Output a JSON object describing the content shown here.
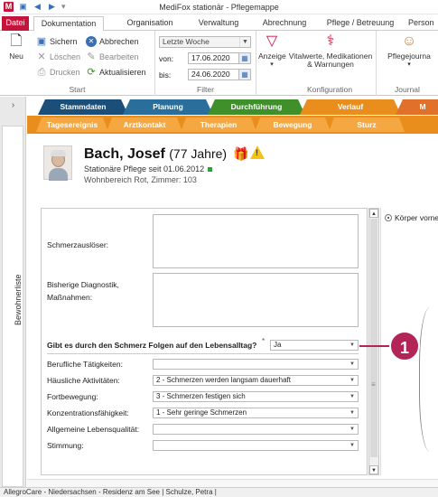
{
  "window": {
    "title": "MediFox stationär - Pflegemappe"
  },
  "quick_access": [
    "app-icon",
    "save-icon",
    "back-arrow-icon",
    "forward-arrow-icon",
    "customize-icon"
  ],
  "ribbon_tabs": [
    {
      "label": "Datei"
    },
    {
      "label": "Dokumentation"
    },
    {
      "label": "Organisation"
    },
    {
      "label": "Verwaltung"
    },
    {
      "label": "Abrechnung"
    },
    {
      "label": "Pflege / Betreuung"
    },
    {
      "label": "Person"
    }
  ],
  "ribbon": {
    "start": {
      "label": "Start",
      "neu": "Neu",
      "sichern": "Sichern",
      "abbrechen": "Abbrechen",
      "loeschen": "Löschen",
      "bearbeiten": "Bearbeiten",
      "drucken": "Drucken",
      "aktualisieren": "Aktualisieren"
    },
    "filter": {
      "label": "Filter",
      "period": "Letzte Woche",
      "von_label": "von:",
      "von": "17.06.2020",
      "bis_label": "bis:",
      "bis": "24.06.2020",
      "anzeige": "Anzeige"
    },
    "konfiguration": {
      "label": "Konfiguration",
      "vital_line1": "Vitalwerte, Medikationen",
      "vital_line2": "& Warnungen"
    },
    "journal": {
      "label": "Journal",
      "pflegejournal": "Pflegejourna"
    }
  },
  "sidebar": {
    "label": "Bewohnerliste"
  },
  "main_tabs": [
    {
      "label": "Stammdaten",
      "color": "#1b4f7a"
    },
    {
      "label": "Planung",
      "color": "#2a6f9c"
    },
    {
      "label": "Durchführung",
      "color": "#3f8f2a"
    },
    {
      "label": "Verlauf",
      "color": "#e98e1c"
    },
    {
      "label": "M",
      "color": "#e0702a"
    }
  ],
  "sub_tabs": [
    {
      "label": "Tagesereignis"
    },
    {
      "label": "Arztkontakt"
    },
    {
      "label": "Therapien"
    },
    {
      "label": "Bewegung"
    },
    {
      "label": "Sturz"
    }
  ],
  "patient": {
    "name": "Bach, Josef",
    "age": "(77 Jahre)",
    "care_line": "Stationäre Pflege  seit 01.06.2012",
    "ward_line": "Wohnbereich Rot, Zimmer: 103"
  },
  "form": {
    "schmerzausloeser": "Schmerzauslöser:",
    "diagnostik_line1": "Bisherige Diagnostik,",
    "diagnostik_line2": "Maßnahmen:",
    "question": "Gibt es durch den Schmerz Folgen auf den Lebensalltag?",
    "required_marker": "*",
    "question_value": "Ja",
    "rows": [
      {
        "label": "Berufliche Tätigkeiten:",
        "value": ""
      },
      {
        "label": "Häusliche Aktivitäten:",
        "value": "2  -  Schmerzen werden langsam dauerhaft"
      },
      {
        "label": "Fortbewegung:",
        "value": "3  -  Schmerzen festigen sich"
      },
      {
        "label": "Konzentrationsfähigkeit:",
        "value": "1  -  Sehr geringe Schmerzen"
      },
      {
        "label": "Allgemeine Lebensqualität:",
        "value": ""
      },
      {
        "label": "Stimmung:",
        "value": ""
      }
    ]
  },
  "right_panel": {
    "radio_label": "Körper vorne"
  },
  "callout": {
    "number": "1"
  },
  "statusbar": {
    "text": "AllegroCare - Niedersachsen - Residenz am See  |  Schulze, Petra  |"
  }
}
